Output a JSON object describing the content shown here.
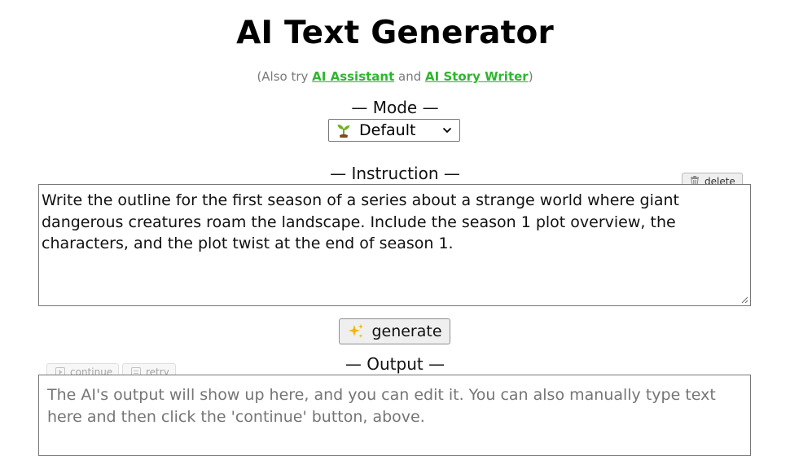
{
  "header": {
    "title": "AI Text Generator",
    "also_try_prefix": "(Also try ",
    "link_assistant": "AI Assistant",
    "also_try_and": " and ",
    "link_story": "AI Story Writer",
    "also_try_suffix": ")"
  },
  "mode": {
    "label": "— Mode —",
    "selected": "Default",
    "icon": "sprout-icon"
  },
  "instruction": {
    "label": "— Instruction —",
    "delete_label": "delete",
    "text": "Write the outline for the first season of a series about a strange world where giant dangerous creatures roam the landscape. Include the season 1 plot overview, the characters, and the plot twist at the end of season 1."
  },
  "generate": {
    "label": "generate",
    "icon": "sparkles-icon"
  },
  "output": {
    "label": "— Output —",
    "continue_label": "continue",
    "retry_label": "retry",
    "placeholder": "The AI's output will show up here, and you can edit it. You can also manually type text here and then click the 'continue' button, above."
  },
  "colors": {
    "link": "#2fb52f",
    "muted_text": "#7a7a7a",
    "placeholder": "#757575",
    "button_bg": "#efefef"
  }
}
